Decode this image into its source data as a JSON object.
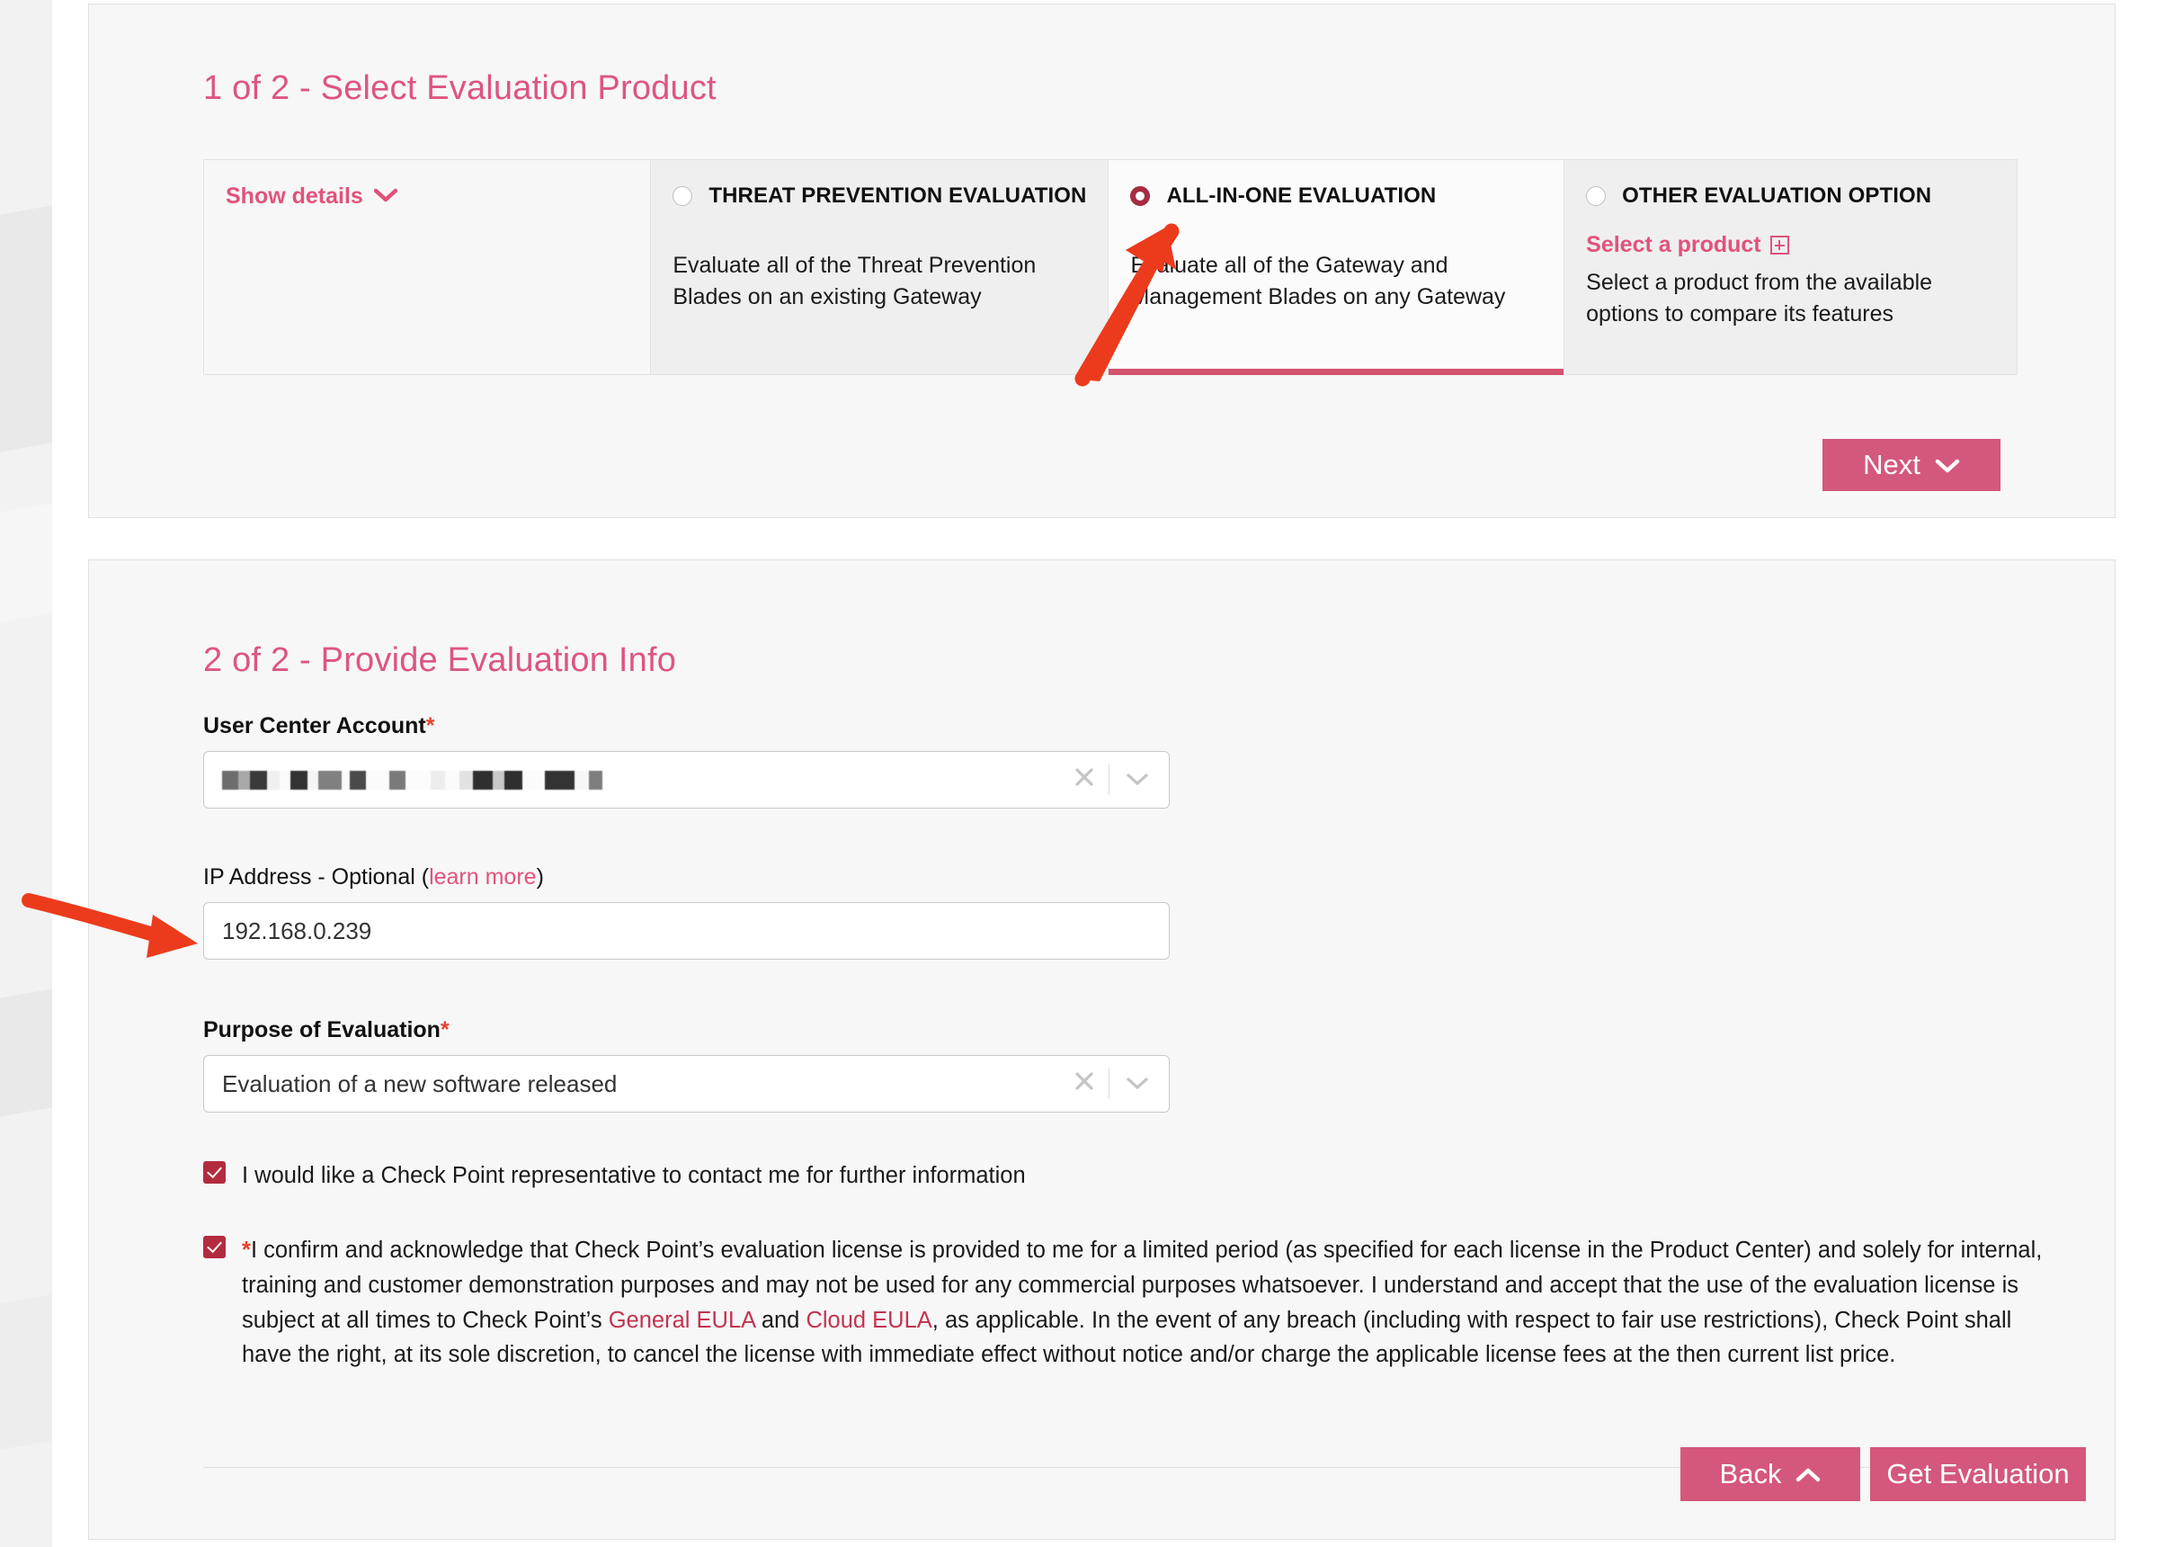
{
  "step1": {
    "title": "1 of 2 - Select Evaluation Product",
    "show_details_label": "Show details",
    "show_details_icon": "chevron-down-icon",
    "options": [
      {
        "id": "threat-prevention-evaluation",
        "title": "THREAT PREVENTION EVALUATION",
        "description": "Evaluate all of the Threat Prevention Blades on an existing Gateway",
        "selected": false
      },
      {
        "id": "all-in-one-evaluation",
        "title": "ALL-IN-ONE EVALUATION",
        "description": "Evaluate all of the Gateway and Management Blades on any Gateway",
        "selected": true
      },
      {
        "id": "other-evaluation-option",
        "title": "OTHER EVALUATION OPTION",
        "link_label": "Select a product",
        "link_icon": "plus-box-icon",
        "description": "Select a product from the available options to compare its features",
        "selected": false
      }
    ],
    "next_button": "Next",
    "next_button_icon": "chevron-down-icon"
  },
  "step2": {
    "title": "2 of 2 - Provide Evaluation Info",
    "user_center_account": {
      "label": "User Center Account",
      "required_marker": "*",
      "value": "",
      "value_state": "redacted",
      "clear_icon": "close-x-icon",
      "dropdown_icon": "chevron-down-icon"
    },
    "ip_address": {
      "label_prefix": "IP Address - Optional (",
      "label_link": "learn more",
      "label_suffix": ")",
      "value": "192.168.0.239",
      "placeholder": ""
    },
    "purpose": {
      "label": "Purpose of Evaluation",
      "required_marker": "*",
      "value": "Evaluation of a new software released",
      "clear_icon": "close-x-icon",
      "dropdown_icon": "chevron-down-icon"
    },
    "checkbox_contact": {
      "checked": true,
      "label": "I would like a Check Point representative to contact me for further information"
    },
    "checkbox_terms": {
      "checked": true,
      "required_marker": "*",
      "text_part1": "I confirm and acknowledge that Check Point’s evaluation license is provided to me for a limited period (as specified for each license in the Product Center) and solely for internal, training and customer demonstration purposes and may not be used for any commercial purposes whatsoever. I understand and accept that the use of the evaluation license is subject at all times to Check Point’s ",
      "link1": "General EULA",
      "text_mid": " and ",
      "link2": "Cloud EULA",
      "text_part2": ", as applicable. In the event of any breach (including with respect to fair use restrictions), Check Point shall have the right, at its sole discretion, to cancel the license with immediate effect without notice and/or charge the applicable license fees at the then current list price."
    },
    "back_button": "Back",
    "back_button_icon": "chevron-up-icon",
    "get_evaluation_button": "Get Evaluation"
  },
  "annotations": [
    {
      "name": "arrow-to-all-in-one-option",
      "icon": "red-arrow-up-right"
    },
    {
      "name": "arrow-to-ip-address-field",
      "icon": "red-arrow-right"
    }
  ],
  "colors": {
    "accent_pink": "#d4587b",
    "title_pink": "#dd5580",
    "link_pink": "#e2527a",
    "checkbox_red": "#b32b3f",
    "radio_selected": "#a52c42",
    "annotation_red": "#ec3b1c",
    "required_star": "#e8412b",
    "card_bg": "#f7f7f7"
  }
}
